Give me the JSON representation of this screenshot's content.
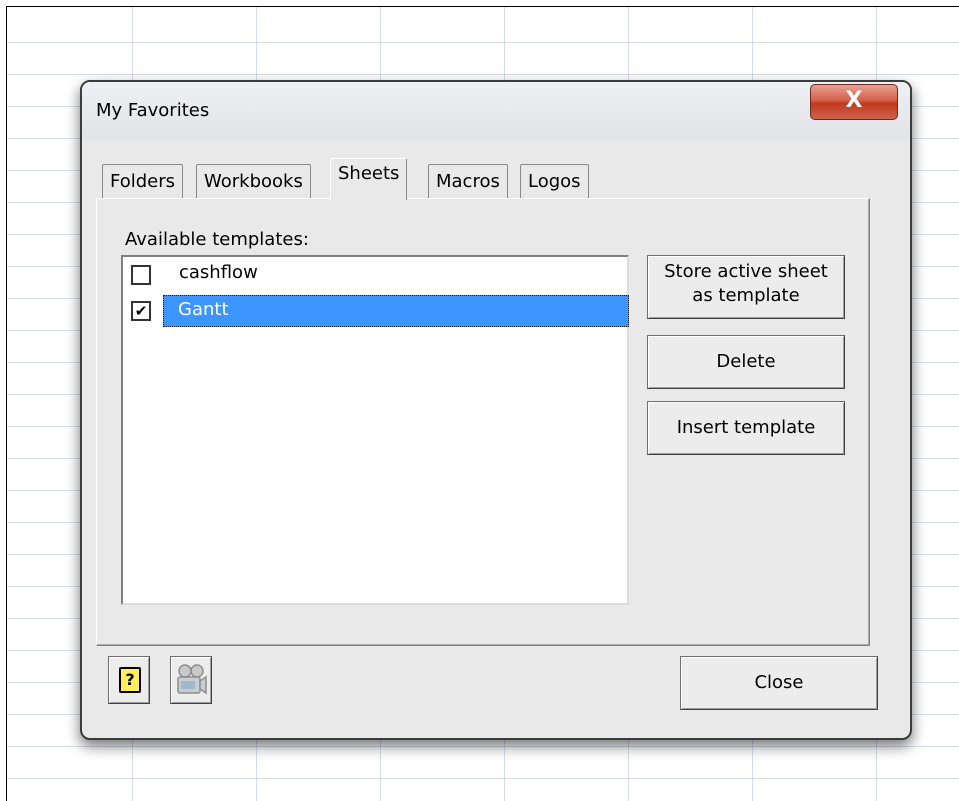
{
  "dialog": {
    "title": "My Favorites",
    "close_glyph": "X"
  },
  "tabs": [
    {
      "label": "Folders",
      "active": false
    },
    {
      "label": "Workbooks",
      "active": false
    },
    {
      "label": "Sheets",
      "active": true
    },
    {
      "label": "Macros",
      "active": false
    },
    {
      "label": "Logos",
      "active": false
    }
  ],
  "sheets_panel": {
    "list_label": "Available templates:",
    "items": [
      {
        "label": "cashflow",
        "checked": false,
        "selected": false
      },
      {
        "label": "Gantt",
        "checked": true,
        "selected": true
      }
    ],
    "check_glyph": "✔",
    "buttons": {
      "store_line1": "Store active sheet",
      "store_line2": "as template",
      "delete": "Delete",
      "insert": "Insert template"
    }
  },
  "footer": {
    "help_icon": "help-icon",
    "help_glyph": "?",
    "video_icon": "video-camera-icon",
    "close": "Close"
  },
  "colors": {
    "selection": "#3d95ff",
    "close_x": "#c0391f",
    "dialog_bg": "#e9e9e9"
  }
}
